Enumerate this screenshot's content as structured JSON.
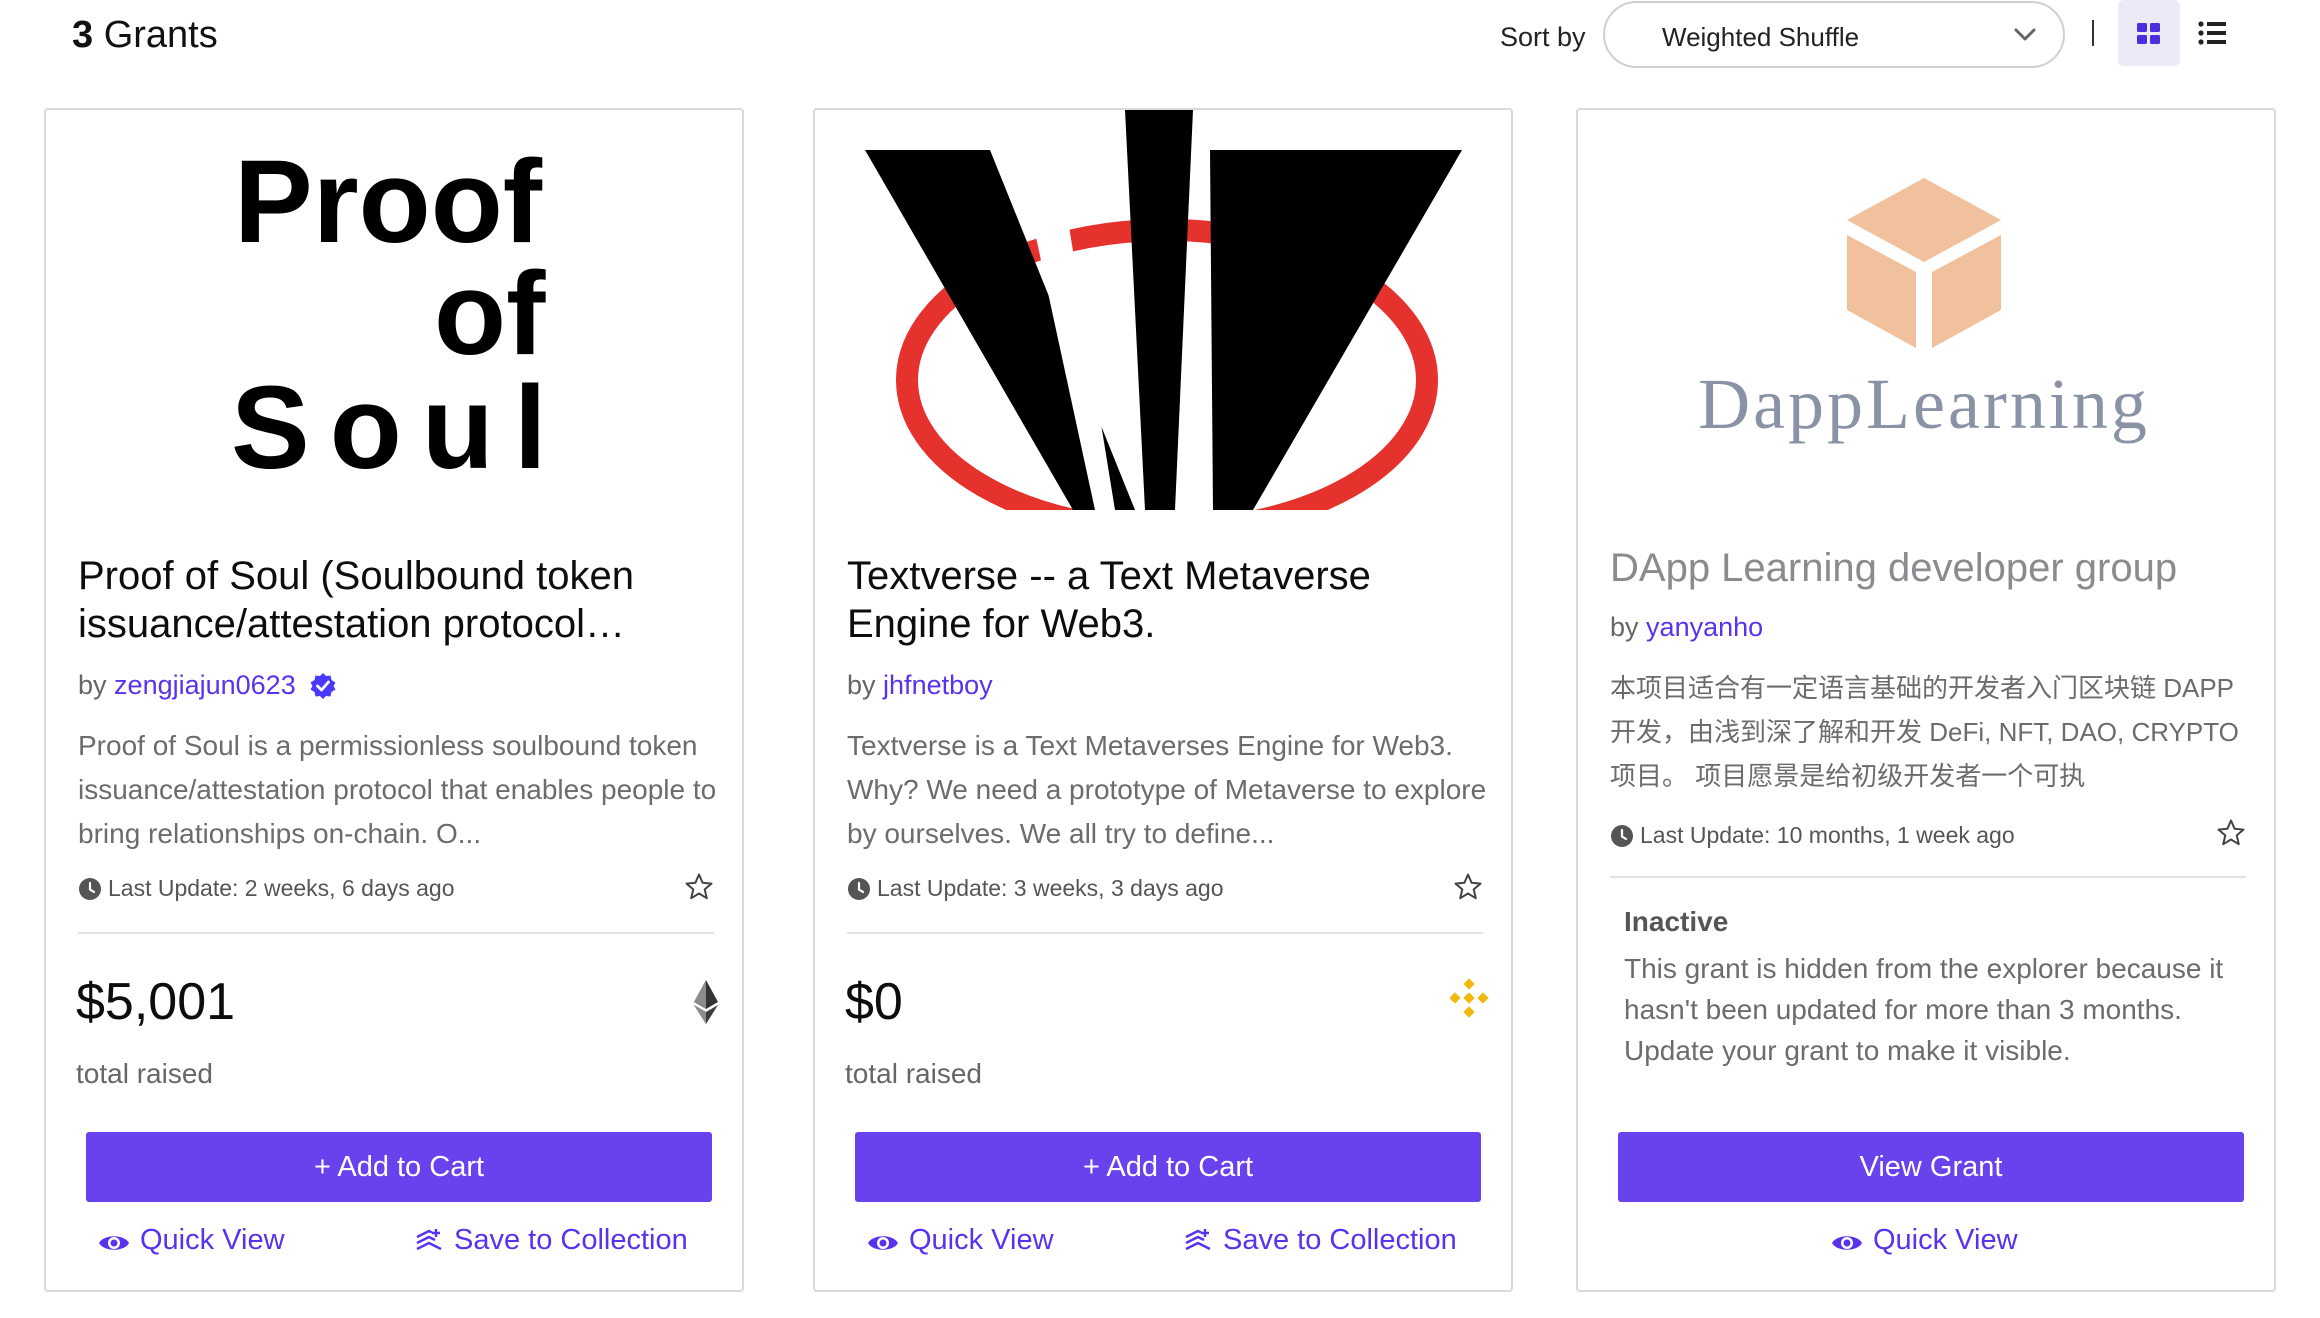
{
  "header": {
    "count": "3",
    "count_label": "Grants",
    "sort_label": "Sort by",
    "sort_value": "Weighted Shuffle"
  },
  "cards": [
    {
      "logo_text": [
        "Proof",
        "of",
        "Soul"
      ],
      "title": "Proof of Soul (Soulbound token issuance/attestation protocol…",
      "by_prefix": "by",
      "owner": "zengjiajun0623",
      "description": "Proof of Soul is a permissionless soulbound token issuance/attestation protocol that enables people to bring relationships on-chain. O...",
      "last_update": "Last Update: 2 weeks, 6 days ago",
      "amount": "$5,001",
      "raised_label": "total raised",
      "currency_icon": "ethereum-icon",
      "button_label": "+ Add to Cart",
      "quick_view": "Quick View",
      "save": "Save to Collection"
    },
    {
      "title": "Textverse -- a Text Metaverse Engine for Web3.",
      "by_prefix": "by",
      "owner": "jhfnetboy",
      "description": "Textverse is a Text Metaverses Engine for Web3. Why? We need a prototype of Metaverse to explore by ourselves. We all try to define...",
      "last_update": "Last Update: 3 weeks, 3 days ago",
      "amount": "$0",
      "raised_label": "total raised",
      "currency_icon": "binance-icon",
      "button_label": "+ Add to Cart",
      "quick_view": "Quick View",
      "save": "Save to Collection"
    },
    {
      "logo_text": "DappLearning",
      "title": "DApp Learning developer group",
      "by_prefix": "by",
      "owner": "yanyanho",
      "description": "本项目适合有一定语言基础的开发者入门区块链 DAPP 开发，由浅到深了解和开发 DeFi, NFT, DAO, CRYPTO 项目。 项目愿景是给初级开发者一个可执",
      "last_update": "Last Update: 10 months, 1 week ago",
      "inactive_title": "Inactive",
      "inactive_text": "This grant is hidden from the explorer because it hasn't been updated for more than 3 months. Update your grant to make it visible.",
      "button_label": "View Grant",
      "quick_view": "Quick View"
    }
  ],
  "colors": {
    "accent": "#6942ed",
    "link": "#5932ed",
    "verified": "#4a3aff",
    "binance": "#f0b90b",
    "dapp_box": "#f0c19c",
    "dapp_text": "#8a93a6",
    "textverse_red": "#e5322d"
  }
}
